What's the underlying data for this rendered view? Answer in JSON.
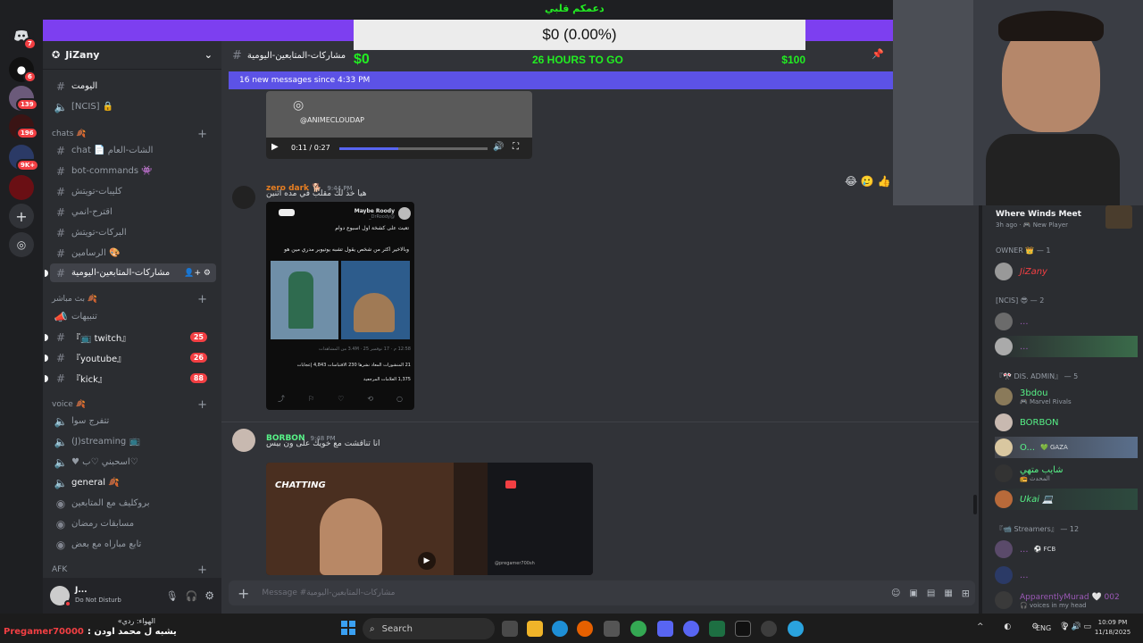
{
  "donation_goal": {
    "top_label": "دعمكم قلبي",
    "amount_display": "$0 (0.00%)",
    "start": "$0",
    "time_left": "26 HOURS TO GO",
    "target": "$100",
    "progress_fraction": 0.0
  },
  "server": {
    "name": "JiZany",
    "rail_badges": [
      "7",
      "6",
      "139",
      "196",
      "9K+"
    ]
  },
  "sidebar": {
    "top_channels": [
      {
        "label": "اليومت"
      },
      {
        "label": "[NCIS] 🔒"
      }
    ],
    "categories": [
      {
        "label": "chats 🍂",
        "channels": [
          {
            "label": "chat 📄 الشات-العام"
          },
          {
            "label": "bot-commands 👾"
          },
          {
            "label": "كليبات-تويتش"
          },
          {
            "label": "اقترح-انمي"
          },
          {
            "label": "البركات-تويتش"
          },
          {
            "label": "الرسامين 🎨"
          },
          {
            "label": "مشاركات-المتابعين-اليومية"
          }
        ]
      },
      {
        "label": "بث مباشر 🍂",
        "channels": [
          {
            "label": "تنبيهات",
            "count": ""
          },
          {
            "label": "『📺 twitch』",
            "count": "25"
          },
          {
            "label": "『youtube』",
            "count": "26"
          },
          {
            "label": "『kick』",
            "count": "88"
          }
        ]
      },
      {
        "label": "voice 🍂",
        "channels": [
          {
            "label": "تتفرج سوا"
          },
          {
            "label": "(J)streaming 📺"
          },
          {
            "label": "♥ اسحبني ♡ب♡"
          },
          {
            "label": "general 🍂"
          },
          {
            "label": "بروكليف مع المتابعين"
          },
          {
            "label": "مسابقات رمضان"
          },
          {
            "label": "تابع مباراه مع بعض"
          }
        ]
      },
      {
        "label": "AFK",
        "channels": []
      }
    ]
  },
  "user_panel": {
    "name": "J...",
    "status": "Do Not Disturb"
  },
  "chat": {
    "channel_name": "مشاركات-المتابعين-اليومية",
    "new_messages_banner": "16 new messages since 4:33 PM",
    "video1": {
      "handle": "@ANIMECLOUDAP",
      "time": "0:11 / 0:27",
      "played_fraction": 0.4
    },
    "messages": [
      {
        "author": "zero dark 🐕",
        "author_color": "#e67e22",
        "time": "9:44 PM",
        "text": "هيا خذ لك مقلب في مده اثنين",
        "tweet": {
          "display_name": "Maybe Roody",
          "handle": "@DrRoody_",
          "line1": "تعبت على كشخة اول اسبوع دوام",
          "line2": "وبالاخير اكثر من شخص يقول تشبه يوتيوبر مدري مين هو",
          "meta": "12:58 م · 17 نوفمبر 25 · 3.4M من المشاهدات",
          "stats": "21 المنشورات المعاد نشرها   230 الاقتباسات   4,843 إعجابات",
          "bookmarks": "1,375 العلامات المرجعية"
        }
      },
      {
        "author": "BORBON",
        "author_color": "#57f287",
        "time": "9:48 PM",
        "text": "انا تناقشت مع خويك على ون بيس",
        "video_label": "CHATTING",
        "video_handle": "@pregamer700sh"
      }
    ],
    "reactions": [
      "😂",
      "🥲",
      "👍"
    ],
    "composer_placeholder": "Message #مشاركات-المتابعين-اليومية"
  },
  "webcam_overlay": {
    "activity_title": "Where Winds Meet",
    "activity_sub": "3h ago · 🎮 New Player"
  },
  "members": {
    "groups": [
      {
        "label": "OWNER 👑 — 1",
        "members": [
          {
            "name": "JiZany",
            "color": "#f23f43",
            "sub": ""
          }
        ]
      },
      {
        "label": "[NCIS] 😎 — 2",
        "members": [
          {
            "name": "...",
            "color": "#9b59b6",
            "sub": ""
          },
          {
            "name": "...",
            "color": "#9b59b6",
            "sub": ""
          }
        ]
      },
      {
        "label": "『🎌 DIS. ADMIN』 — 5",
        "members": [
          {
            "name": "3bdou",
            "color": "#57f287",
            "sub": "🎮 Marvel Rivals"
          },
          {
            "name": "BORBON",
            "color": "#57f287",
            "sub": ""
          },
          {
            "name": "O...",
            "color": "#57f287",
            "sub": "💚 GAZA"
          },
          {
            "name": "شايب متهي",
            "color": "#57f287",
            "sub": "📻 المحدث"
          },
          {
            "name": "Ukai 💻",
            "color": "#57f287",
            "sub": ""
          }
        ]
      },
      {
        "label": "『📹 Streamers』 — 12",
        "members": [
          {
            "name": "...",
            "color": "#9b59b6",
            "sub": "⚽ FCB"
          },
          {
            "name": "...",
            "color": "#9b59b6",
            "sub": ""
          },
          {
            "name": "ApparentlyMurad 🤍 002",
            "color": "#9b59b6",
            "sub": "🎧 voices in my head"
          }
        ]
      }
    ]
  },
  "stream_overlay": {
    "ticker_prefix": "Pregamer70000",
    "ticker_text": ": يشبه ل محمد اودن",
    "ticker_label": "الهواء: ردي»"
  },
  "taskbar": {
    "search_placeholder": "Search",
    "language": "ENG",
    "time": "10:09 PM",
    "date": "11/18/2025"
  },
  "colors": {
    "accent_purple": "#7d3ff0",
    "banner_blue": "#5c52e6",
    "goal_green": "#22ee22",
    "discord_bg": "#313338"
  }
}
